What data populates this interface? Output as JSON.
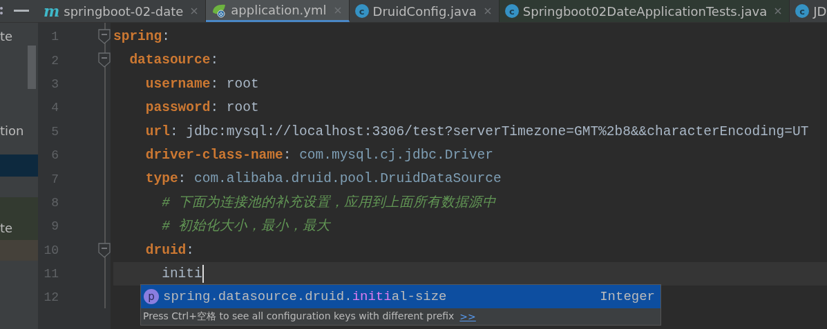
{
  "tabs": [
    {
      "label": "springboot-02-date",
      "kind": "module",
      "icon_char": "m",
      "selected": false,
      "closable": true
    },
    {
      "label": "application.yml",
      "kind": "spring",
      "selected": true,
      "closable": true
    },
    {
      "label": "DruidConfig.java",
      "kind": "class",
      "icon_char": "c",
      "selected": false,
      "closable": true
    },
    {
      "label": "Springboot02DateApplicationTests.java",
      "kind": "test",
      "icon_char": "c",
      "selected": false,
      "closable": true
    },
    {
      "label": "JD",
      "kind": "class",
      "icon_char": "c",
      "selected": false,
      "closable": false
    }
  ],
  "side_panel": {
    "items": [
      {
        "text": "te",
        "kind": "plain"
      },
      {
        "text": "tion",
        "kind": "plain"
      },
      {
        "kind": "selected"
      },
      {
        "text": "te",
        "kind": "green"
      },
      {
        "kind": "brown"
      }
    ]
  },
  "line_numbers": [
    "1",
    "2",
    "3",
    "4",
    "5",
    "6",
    "7",
    "8",
    "9",
    "10",
    "11",
    "12"
  ],
  "code": [
    {
      "kind": "mapping",
      "key": "spring",
      "sep": ":",
      "children": [
        {
          "kind": "mapping",
          "key": "datasource",
          "sep": ":",
          "children": [
            {
              "kind": "scalar",
              "key": "username",
              "sep": ":",
              "value": "root"
            },
            {
              "kind": "scalar",
              "key": "password",
              "sep": ":",
              "value": "root"
            },
            {
              "kind": "scalar",
              "key": "url",
              "sep": ":",
              "value": "jdbc:mysql://localhost:3306/test?serverTimezone=GMT%2b8&&characterEncoding=UT"
            },
            {
              "kind": "class_name",
              "key": "driver-class-name",
              "sep": ":",
              "value": "com.mysql.cj.jdbc.Driver"
            },
            {
              "kind": "class_name",
              "key": "type",
              "sep": ":",
              "value": "com.alibaba.druid.pool.DruidDataSource",
              "children": [
                {
                  "kind": "comment",
                  "text": "# 下面为连接池的补充设置，应用到上面所有数据源中"
                },
                {
                  "kind": "comment",
                  "text": "# 初始化大小，最小，最大"
                }
              ]
            },
            {
              "kind": "mapping",
              "key": "druid",
              "sep": ":",
              "children": [
                {
                  "kind": "typing",
                  "text": "initi",
                  "caret": true
                }
              ]
            }
          ]
        }
      ]
    }
  ],
  "completion": {
    "items": [
      {
        "icon_char": "p",
        "prefix": "spring.datasource.druid.",
        "match": "initi",
        "rest": "al-size",
        "type": "Integer",
        "selected": true
      }
    ],
    "hint": "Press Ctrl+空格 to see all configuration keys with different prefix",
    "hint_link": ">>"
  }
}
